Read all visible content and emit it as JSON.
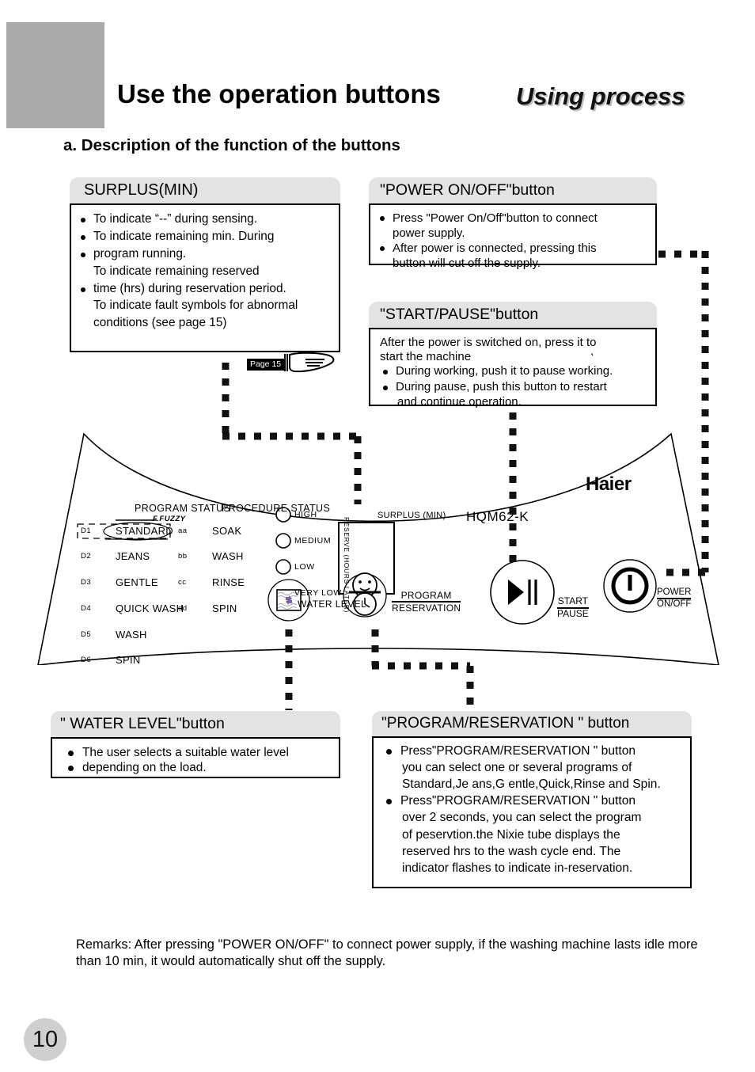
{
  "header": {
    "title": "Use the operation buttons",
    "subtitle": "Using process",
    "section_a": "a.  Description of the function of the buttons"
  },
  "boxes": {
    "surplus": {
      "caption": "SURPLUS(MIN)",
      "lines": [
        "To indicate “--” during sensing.",
        "To indicate remaining min. During",
        "program running.",
        "To indicate remaining reserved",
        "time (hrs) during reservation period.",
        "To indicate fault symbols for abnormal",
        "conditions (see page 15)"
      ],
      "page_tag": "Page 15"
    },
    "power": {
      "caption": "\"POWER ON/OFF\"button",
      "lines": [
        "Press \"Power On/Off\"button to connect",
        "power supply.",
        "After power is connected, pressing this",
        "button will cut off the supply."
      ]
    },
    "start": {
      "caption": "\"START/PAUSE\"button",
      "lead": [
        "After the power is switched on, press it to",
        "start the machine"
      ],
      "lines": [
        "During working, push it to pause working.",
        "During pause, push this button to restart",
        "and continue operation."
      ]
    },
    "water": {
      "caption": "\" WATER LEVEL\"button",
      "lines": [
        "The user selects a suitable water level",
        "depending on the load."
      ]
    },
    "program": {
      "caption": "\"PROGRAM/RESERVATION \" button",
      "lines": [
        "Press\"PROGRAM/RESERVATION \" button",
        " you can select one or several programs of",
        "Standard,Je ans,G entle,Quick,Rinse and Spin.",
        "Press\"PROGRAM/RESERVATION \" button",
        "over 2 seconds, you can select  the program",
        "of  peservtion.the Nixie tube displays the",
        "reserved hrs to the wash cycle end. The",
        "indicator flashes to indicate in-reservation."
      ]
    }
  },
  "panel": {
    "program_status_title": "PROGRAM STATUS",
    "procedure_status_title": "PROCEDURE STATUS",
    "fuzzy_label": "F.FUZZY",
    "programs": [
      {
        "code": "D1",
        "name": "STANDARD"
      },
      {
        "code": "D2",
        "name": "JEANS"
      },
      {
        "code": "D3",
        "name": "GENTLE"
      },
      {
        "code": "D4",
        "name": "QUICK  WASH"
      },
      {
        "code": "D5",
        "name": "WASH"
      },
      {
        "code": "D6",
        "name": "SPIN"
      }
    ],
    "procedures": [
      {
        "code": "aa",
        "name": "SOAK"
      },
      {
        "code": "bb",
        "name": "WASH"
      },
      {
        "code": "cc",
        "name": "RINSE"
      },
      {
        "code": "dd",
        "name": "SPIN"
      }
    ],
    "water_levels": [
      "HIGH",
      "MEDIUM",
      "LOW",
      "VERY LOW"
    ],
    "surplus_label": "SURPLUS (MIN)",
    "reserve_label": "RESERVE (HOURS LATER)",
    "brand": "Haier",
    "model": "HQM62-K",
    "water_level_button_label": "WATER LEVEL",
    "program_label_top": "PROGRAM",
    "program_label_bottom": "RESERVATION",
    "start_label_top": "START",
    "start_label_bottom": "PAUSE",
    "power_label_top": "POWER",
    "power_label_bottom": "ON/OFF"
  },
  "remarks": "Remarks: After pressing \"POWER ON/OFF\" to connect power supply, if the washing machine lasts idle more than 10 min, it would automatically shut off the supply.",
  "page_number": "10"
}
